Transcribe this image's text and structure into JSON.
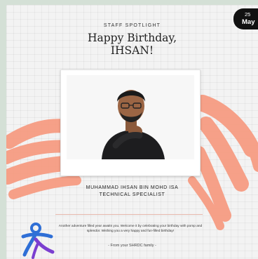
{
  "card": {
    "eyebrow": "STAFF SPOTLIGHT",
    "title_line1": "Happy Birthday,",
    "title_line2": "IHSAN!",
    "person_name": "MUHAMMAD IHSAN BIN MOHD ISA",
    "person_role": "TECHNICAL SPECIALIST",
    "message": "Another adventure filled year awaits you. Welcome it by celebrating your birthday with pomp and splendor. Wishing you a very happy and fun-filled birthday!",
    "signoff": "- From your SHRDC family -"
  },
  "date_badge": {
    "day": "25",
    "month": "May"
  },
  "colors": {
    "accent_stroke": "#f79a7f",
    "badge_background": "#111111",
    "logo_blue": "#2f6fd6",
    "logo_purple": "#7b3fd0"
  }
}
